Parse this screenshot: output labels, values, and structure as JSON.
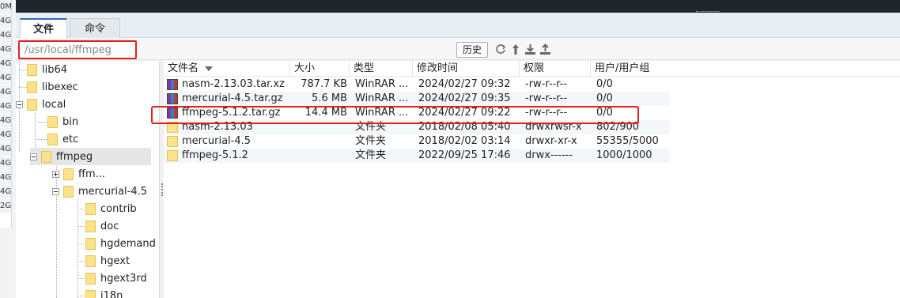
{
  "left_strip": [
    "0M",
    "4G",
    "4G",
    "4G",
    "4G",
    "4G",
    "4G",
    "4G",
    "4G",
    "4G",
    "4G",
    "4G",
    "4G",
    "4G",
    "2G"
  ],
  "tabs": [
    {
      "label": "文件",
      "active": true
    },
    {
      "label": "命令",
      "active": false
    }
  ],
  "path": {
    "value": "/usr/local/ffmpeg"
  },
  "toolbar": {
    "history_label": "历史",
    "icons": [
      "refresh-icon",
      "upload-icon",
      "download-icon",
      "upload-file-icon"
    ]
  },
  "tree": {
    "items": [
      {
        "label": "lib64"
      },
      {
        "label": "libexec"
      },
      {
        "label": "local"
      },
      {
        "label": "bin"
      },
      {
        "label": "etc"
      },
      {
        "label": "ffmpeg"
      },
      {
        "label": "ffm..."
      },
      {
        "label": "mercurial-4.5"
      },
      {
        "label": "contrib"
      },
      {
        "label": "doc"
      },
      {
        "label": "hgdemand"
      },
      {
        "label": "hgext"
      },
      {
        "label": "hgext3rd"
      },
      {
        "label": "i18n"
      }
    ]
  },
  "file_list": {
    "headers": {
      "name": "文件名",
      "size": "大小",
      "type": "类型",
      "mtime": "修改时间",
      "perm": "权限",
      "owner": "用户/用户组"
    },
    "rows": [
      {
        "name": "nasm-2.13.03.tar.xz",
        "size": "787.7 KB",
        "type": "WinRAR ...",
        "mtime": "2024/02/27 09:32",
        "perm": "-rw-r--r--",
        "owner": "0/0",
        "icon": "archive-icon"
      },
      {
        "name": "mercurial-4.5.tar.gz",
        "size": "5.6 MB",
        "type": "WinRAR ...",
        "mtime": "2024/02/27 09:35",
        "perm": "-rw-r--r--",
        "owner": "0/0",
        "icon": "archive-icon"
      },
      {
        "name": "ffmpeg-5.1.2.tar.gz",
        "size": "14.4 MB",
        "type": "WinRAR ...",
        "mtime": "2024/02/27 09:22",
        "perm": "-rw-r--r--",
        "owner": "0/0",
        "icon": "archive-icon"
      },
      {
        "name": "nasm-2.13.03",
        "size": "",
        "type": "文件夹",
        "mtime": "2018/02/08 05:40",
        "perm": "drwxrwsr-x",
        "owner": "802/900",
        "icon": "folder-icon"
      },
      {
        "name": "mercurial-4.5",
        "size": "",
        "type": "文件夹",
        "mtime": "2018/02/02 03:14",
        "perm": "drwxr-xr-x",
        "owner": "55355/5000",
        "icon": "folder-icon"
      },
      {
        "name": "ffmpeg-5.1.2",
        "size": "",
        "type": "文件夹",
        "mtime": "2022/09/25 17:46",
        "perm": "drwx------",
        "owner": "1000/1000",
        "icon": "folder-icon"
      }
    ]
  },
  "colors": {
    "highlight": "#e02020",
    "accent": "#2d6db5",
    "folder": "#fce38a"
  }
}
